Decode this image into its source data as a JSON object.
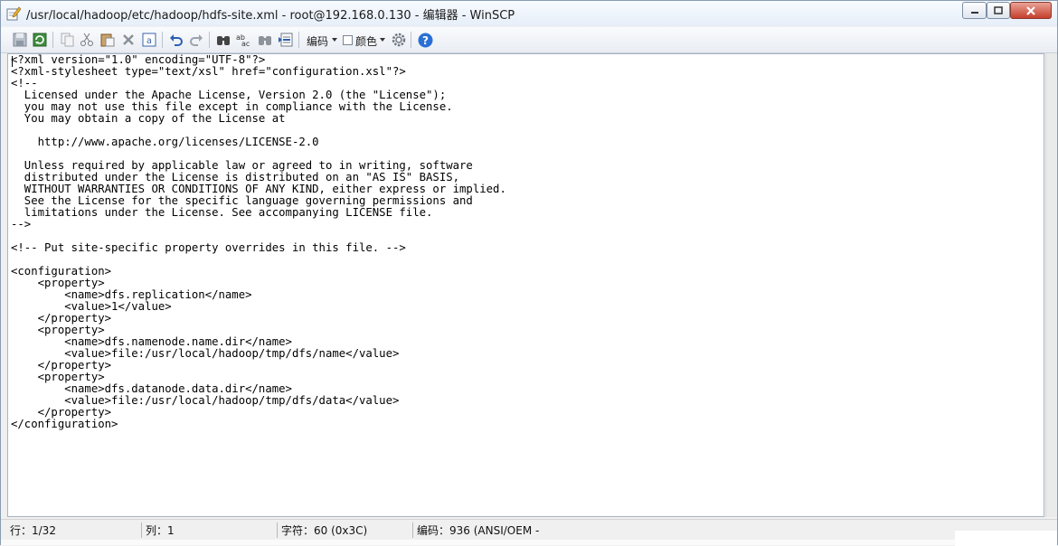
{
  "window": {
    "title": "/usr/local/hadoop/etc/hadoop/hdfs-site.xml - root@192.168.0.130 - 编辑器 - WinSCP"
  },
  "toolbar": {
    "encoding_label": "编码",
    "color_label": "颜色",
    "icons": [
      "save-icon",
      "reload-icon",
      "copy-icon",
      "cut-icon",
      "paste-icon",
      "delete-icon",
      "select-all-icon",
      "undo-icon",
      "redo-icon",
      "find-icon",
      "replace-icon",
      "find-next-icon",
      "goto-line-icon",
      "settings-icon",
      "help-icon"
    ]
  },
  "editor": {
    "content": "<?xml version=\"1.0\" encoding=\"UTF-8\"?>\n<?xml-stylesheet type=\"text/xsl\" href=\"configuration.xsl\"?>\n<!--\n  Licensed under the Apache License, Version 2.0 (the \"License\");\n  you may not use this file except in compliance with the License.\n  You may obtain a copy of the License at\n\n    http://www.apache.org/licenses/LICENSE-2.0\n\n  Unless required by applicable law or agreed to in writing, software\n  distributed under the License is distributed on an \"AS IS\" BASIS,\n  WITHOUT WARRANTIES OR CONDITIONS OF ANY KIND, either express or implied.\n  See the License for the specific language governing permissions and\n  limitations under the License. See accompanying LICENSE file.\n-->\n\n<!-- Put site-specific property overrides in this file. -->\n\n<configuration>\n    <property>\n        <name>dfs.replication</name>\n        <value>1</value>\n    </property>\n    <property>\n        <name>dfs.namenode.name.dir</name>\n        <value>file:/usr/local/hadoop/tmp/dfs/name</value>\n    </property>\n    <property>\n        <name>dfs.datanode.data.dir</name>\n        <value>file:/usr/local/hadoop/tmp/dfs/data</value>\n    </property>\n</configuration>"
  },
  "status": {
    "line": "行：1/32",
    "column": "列：1",
    "char": "字符：60 (0x3C)",
    "encoding": "编码：936   (ANSI/OEM -"
  },
  "colors": {
    "help_blue": "#2a6fd6",
    "close_red": "#c5402c"
  }
}
